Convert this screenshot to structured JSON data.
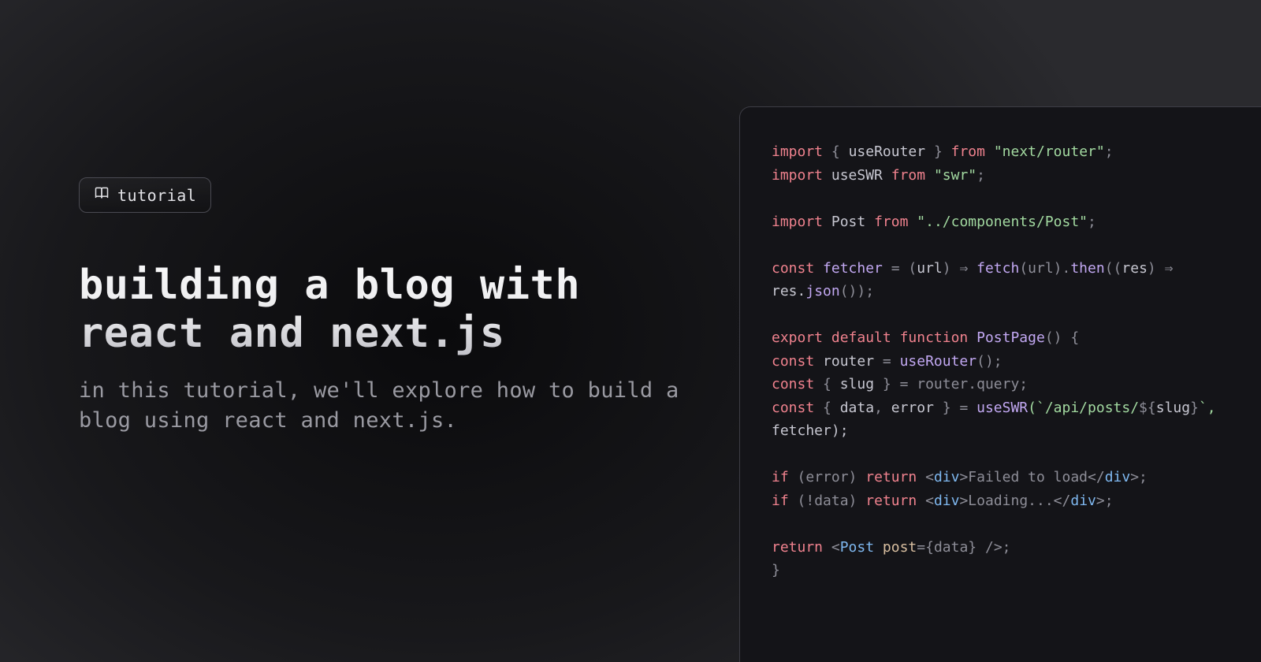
{
  "badge": {
    "label": "tutorial"
  },
  "title": "building a blog with react and next.js",
  "subtitle": "in this tutorial, we'll explore how to build a blog using react and next.js.",
  "code": {
    "line1": {
      "a": "import",
      "b": "{ ",
      "c": "useRouter",
      "d": " }",
      "e": " from ",
      "f": "\"next/router\"",
      "g": ";"
    },
    "line2": {
      "a": "import",
      "b": " ",
      "c": "useSWR",
      "d": " from ",
      "e": "\"swr\"",
      "f": ";"
    },
    "line4": {
      "a": "import",
      "b": " ",
      "c": "Post",
      "d": " from ",
      "e": "\"../components/Post\"",
      "f": ";"
    },
    "line6a": {
      "a": "const",
      "b": " ",
      "c": "fetcher",
      "d": " = (",
      "e": "url",
      "f": ") ⇒ ",
      "g": "fetch",
      "h": "(url).",
      "i": "then",
      "j": "((",
      "k": "res",
      "l": ") ⇒"
    },
    "line6b": {
      "a": "res.",
      "b": "json",
      "c": "());"
    },
    "line8": {
      "a": "export",
      "b": " ",
      "c": "default",
      "d": " ",
      "e": "function",
      "f": " ",
      "g": "PostPage",
      "h": "() {"
    },
    "line9": {
      "a": "const",
      "b": " ",
      "c": "router",
      "d": " = ",
      "e": "useRouter",
      "f": "();"
    },
    "line10": {
      "a": "const",
      "b": " { ",
      "c": "slug",
      "d": " } = router.query;"
    },
    "line11a": {
      "a": "const",
      "b": " { ",
      "c": "data",
      "d": ", ",
      "e": "error",
      "f": " } = ",
      "g": "useSWR",
      "h": "(`/api/posts/",
      "i": "${",
      "j": "slug",
      "k": "}",
      "l": "`,"
    },
    "line11b": {
      "a": "fetcher);"
    },
    "line13": {
      "a": "if",
      "b": " (error) ",
      "c": "return",
      "d": " <",
      "e": "div",
      "f": ">Failed to load</",
      "g": "div",
      "h": ">;"
    },
    "line14": {
      "a": "if",
      "b": " (!data) ",
      "c": "return",
      "d": " <",
      "e": "div",
      "f": ">Loading...</",
      "g": "div",
      "h": ">;"
    },
    "line16": {
      "a": "return",
      "b": " <",
      "c": "Post",
      "d": " ",
      "e": "post",
      "f": "={data} />;"
    },
    "line17": {
      "a": "}"
    }
  }
}
